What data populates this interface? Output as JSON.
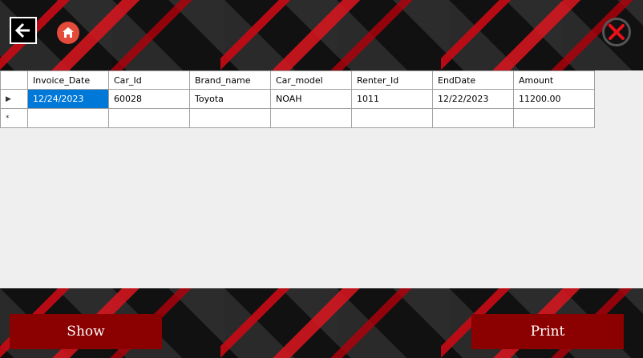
{
  "nav": {
    "back_icon": "arrow-left-icon",
    "home_icon": "home-icon",
    "close_icon": "close-x-icon"
  },
  "grid": {
    "columns": [
      "Invoice_Date",
      "Car_Id",
      "Brand_name",
      "Car_model",
      "Renter_Id",
      "EndDate",
      "Amount"
    ],
    "rows": [
      [
        "12/24/2023",
        "60028",
        "Toyota",
        "NOAH",
        "1011",
        "12/22/2023",
        "11200.00"
      ]
    ],
    "current_row_marker": "▶",
    "new_row_marker": "*"
  },
  "buttons": {
    "show_label": "Show",
    "print_label": "Print"
  },
  "colors": {
    "accent": "#8b0000",
    "selection": "#0078d7",
    "home": "#e44b3a"
  }
}
